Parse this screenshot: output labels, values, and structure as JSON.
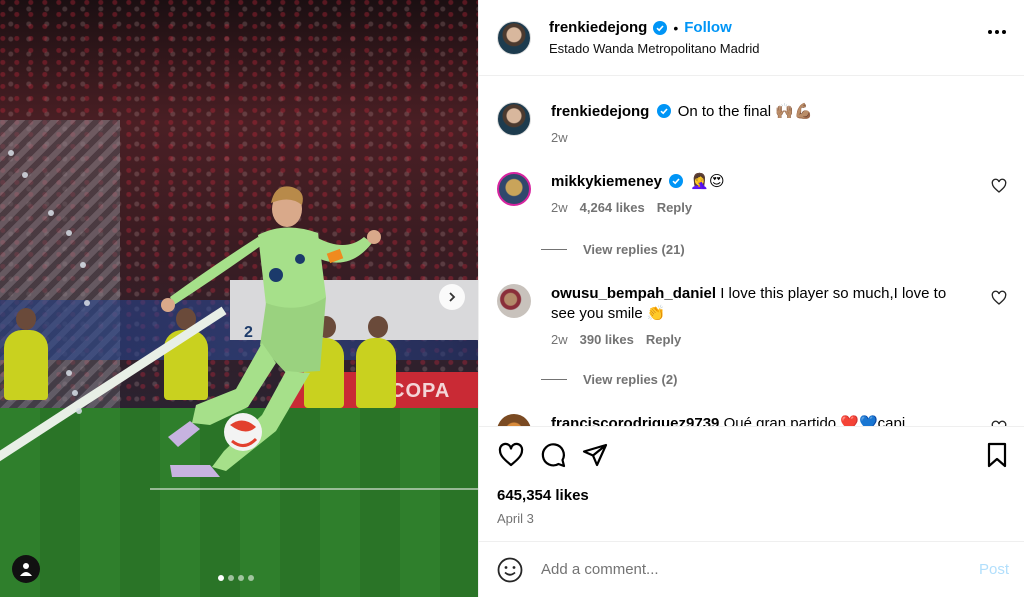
{
  "post": {
    "username": "frenkiedejong",
    "separator": "•",
    "follow_label": "Follow",
    "location": "Estado Wanda Metropolitano Madrid",
    "likes": "645,354 likes",
    "date": "April 3",
    "media": {
      "ad_text": "COPA",
      "slide_count": 4,
      "active_slide": 1
    }
  },
  "caption": {
    "username": "frenkiedejong",
    "text": "On to the final 🙌🏽💪🏽",
    "time": "2w"
  },
  "comments": [
    {
      "username": "mikkykiemeney",
      "verified": true,
      "text": "🤦‍♀️😍",
      "time": "2w",
      "likes": "4,264 likes",
      "reply_label": "Reply",
      "view_replies": "View replies (21)"
    },
    {
      "username": "owusu_bempah_daniel",
      "verified": false,
      "text": "I love this player so much,I love to see you smile 👏",
      "time": "2w",
      "likes": "390 likes",
      "reply_label": "Reply",
      "view_replies": "View replies (2)"
    },
    {
      "username": "franciscorodriguez9739",
      "verified": false,
      "text": "Qué gran partido ❤️💙capi",
      "time": "",
      "likes": "",
      "reply_label": "",
      "view_replies": ""
    }
  ],
  "add_comment": {
    "placeholder": "Add a comment...",
    "post_label": "Post"
  },
  "colors": {
    "accent": "#0095f6",
    "muted": "#737373",
    "post_disabled": "#b2dffc"
  }
}
